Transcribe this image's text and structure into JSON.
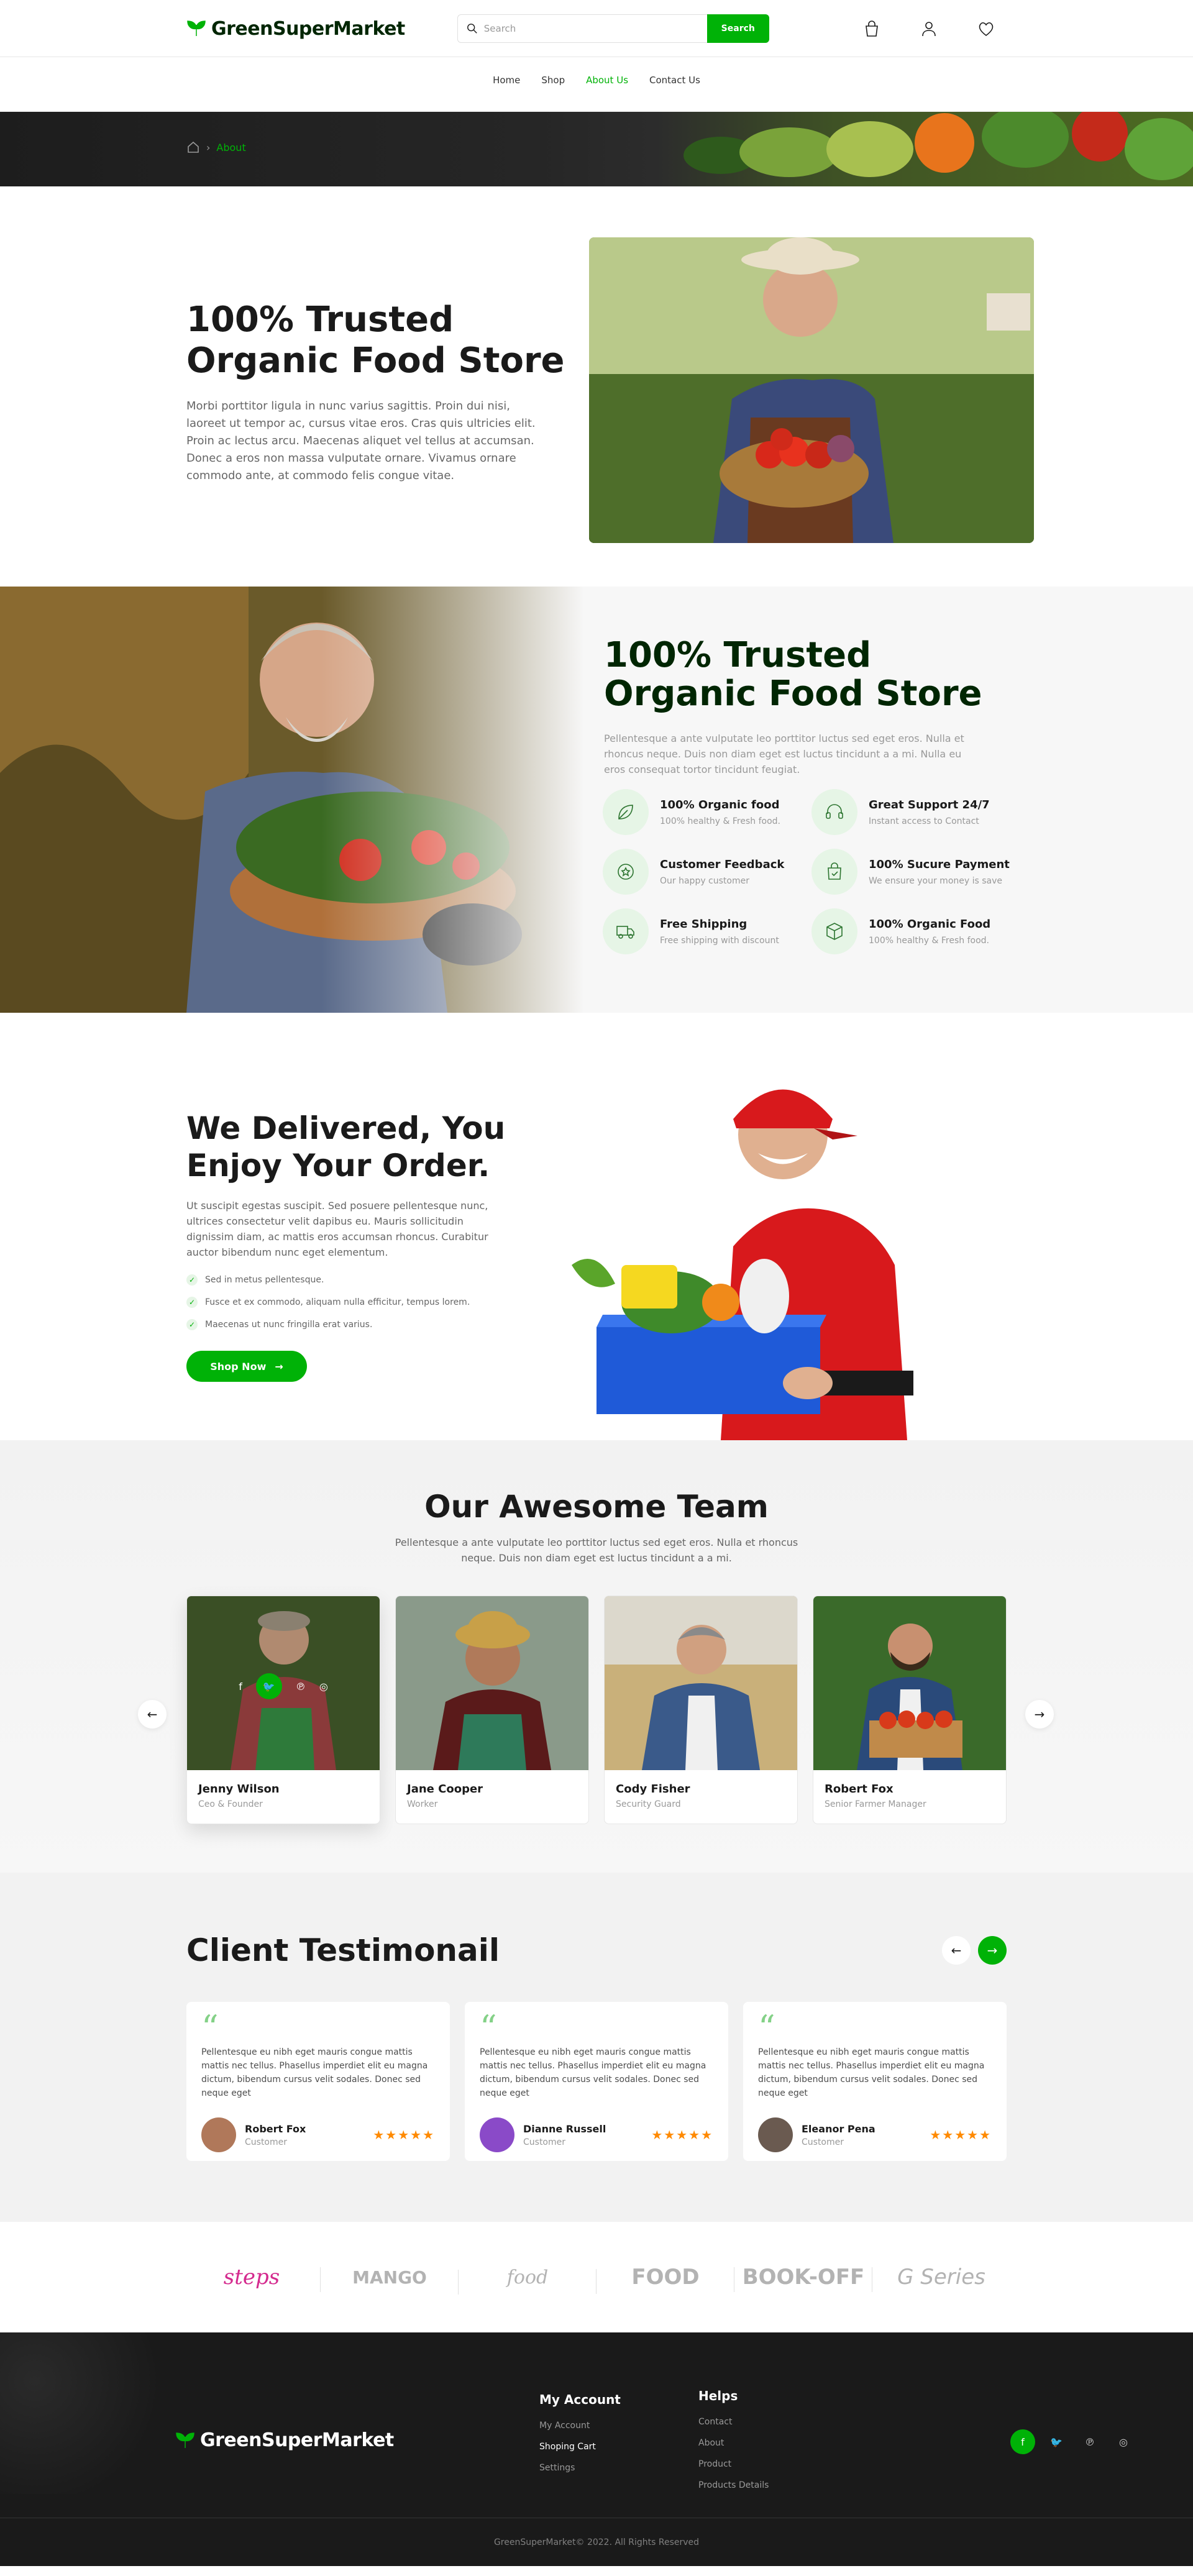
{
  "header": {
    "logo": "GreenSuperMarket",
    "search_placeholder": "Search",
    "search_button": "Search",
    "icons": [
      "bag-icon",
      "user-icon",
      "heart-icon"
    ]
  },
  "nav": [
    "Home",
    "Shop",
    "About Us",
    "Contact Us"
  ],
  "breadcrumb": {
    "current": "About"
  },
  "about1": {
    "title_line1": "100% Trusted",
    "title_line2": "Organic Food Store",
    "text": "Morbi porttitor ligula in nunc varius sagittis. Proin dui nisi, laoreet ut tempor ac, cursus vitae eros. Cras quis ultricies elit. Proin ac lectus arcu. Maecenas aliquet vel tellus at accumsan. Donec a eros non massa vulputate ornare. Vivamus ornare commodo ante, at commodo felis congue vitae."
  },
  "about2": {
    "title_line1": "100% Trusted",
    "title_line2": "Organic Food Store",
    "text": "Pellentesque a ante vulputate leo porttitor luctus sed eget eros. Nulla et rhoncus neque. Duis non diam eget est luctus tincidunt a a mi. Nulla eu eros consequat tortor tincidunt feugiat.",
    "features": [
      {
        "title": "100% Organic food",
        "sub": "100% healthy & Fresh food.",
        "icon": "leaf-icon"
      },
      {
        "title": "Great Support 24/7",
        "sub": "Instant access to Contact",
        "icon": "headphones-icon"
      },
      {
        "title": "Customer Feedback",
        "sub": "Our happy customer",
        "icon": "star-badge-icon"
      },
      {
        "title": "100% Sucure Payment",
        "sub": "We ensure your money is save",
        "icon": "shopping-bag-icon"
      },
      {
        "title": "Free Shipping",
        "sub": "Free shipping with discount",
        "icon": "truck-icon"
      },
      {
        "title": "100% Organic Food",
        "sub": "100% healthy & Fresh food.",
        "icon": "box-icon"
      }
    ]
  },
  "delivered": {
    "title_line1": "We Delivered, You",
    "title_line2": "Enjoy Your Order.",
    "text": "Ut suscipit egestas suscipit. Sed posuere pellentesque nunc, ultrices consectetur velit dapibus eu. Mauris sollicitudin dignissim diam, ac mattis eros accumsan rhoncus. Curabitur auctor bibendum nunc eget elementum.",
    "bullets": [
      "Sed in metus pellentesque.",
      "Fusce et ex commodo, aliquam nulla efficitur, tempus lorem.",
      "Maecenas ut nunc fringilla erat varius."
    ],
    "button": "Shop Now"
  },
  "team": {
    "title": "Our Awesome Team",
    "text": "Pellentesque a ante vulputate leo porttitor luctus sed eget eros. Nulla et rhoncus neque. Duis non diam eget est luctus tincidunt a a mi.",
    "members": [
      {
        "name": "Jenny Wilson",
        "role": "Ceo & Founder"
      },
      {
        "name": "Jane Cooper",
        "role": "Worker"
      },
      {
        "name": "Cody Fisher",
        "role": "Security Guard"
      },
      {
        "name": "Robert Fox",
        "role": "Senior Farmer Manager"
      }
    ]
  },
  "testimonial": {
    "title": "Client Testimonail",
    "items": [
      {
        "text": "Pellentesque eu nibh eget mauris congue mattis mattis nec tellus. Phasellus imperdiet elit eu magna dictum, bibendum cursus velit sodales. Donec sed neque eget",
        "name": "Robert Fox",
        "role": "Customer",
        "rating": 5
      },
      {
        "text": "Pellentesque eu nibh eget mauris congue mattis mattis nec tellus. Phasellus imperdiet elit eu magna dictum, bibendum cursus velit sodales. Donec sed neque eget",
        "name": "Dianne Russell",
        "role": "Customer",
        "rating": 5
      },
      {
        "text": "Pellentesque eu nibh eget mauris congue mattis mattis nec tellus. Phasellus imperdiet elit eu magna dictum, bibendum cursus velit sodales. Donec sed neque eget",
        "name": "Eleanor Pena",
        "role": "Customer",
        "rating": 5
      }
    ]
  },
  "brands": [
    "steps",
    "MANGO",
    "food",
    "FOOD",
    "BOOK-OFF",
    "G Series"
  ],
  "footer": {
    "logo": "GreenSuperMarket",
    "col1": {
      "title": "My Account",
      "links": [
        "My Account",
        "Shoping Cart",
        "Settings"
      ]
    },
    "col2": {
      "title": "Helps",
      "links": [
        "Contact",
        "About",
        "Product",
        "Products Details"
      ]
    },
    "copyright": "GreenSuperMarket© 2022. All Rights Reserved"
  },
  "colors": {
    "brand": "#00b207",
    "dark": "#1a1a1a",
    "rating": "#ff8a00"
  }
}
